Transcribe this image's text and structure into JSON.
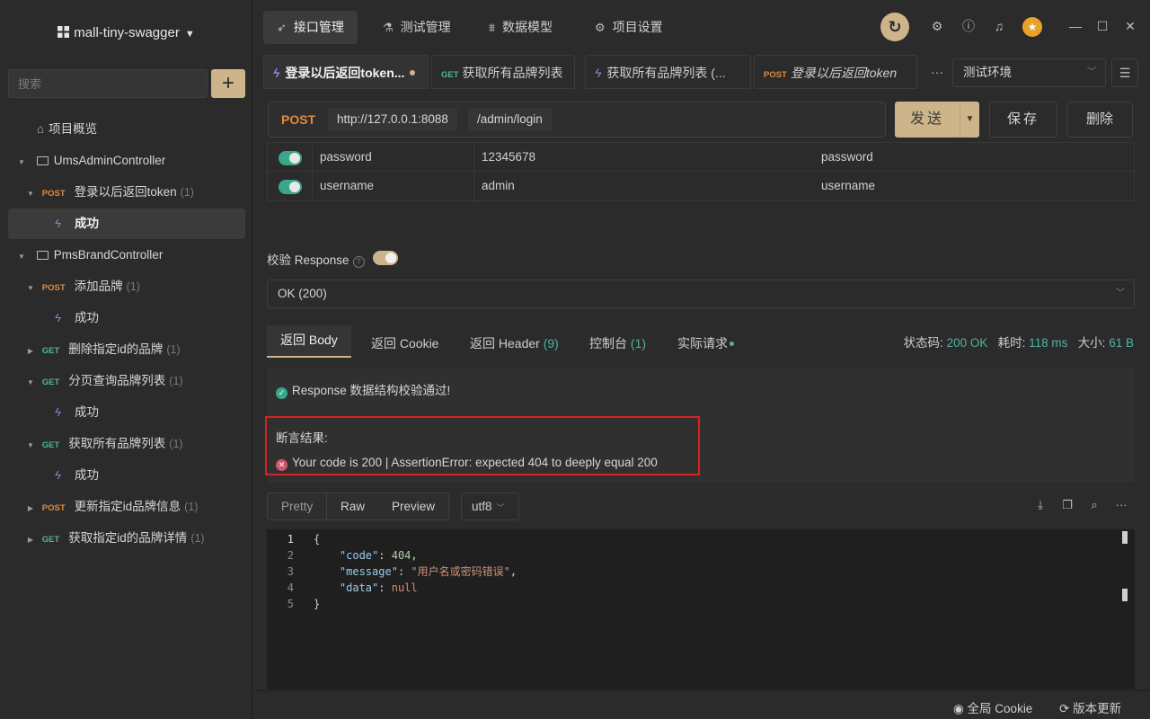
{
  "project": {
    "name": "mall-tiny-swagger"
  },
  "search": {
    "placeholder": "搜索"
  },
  "sidebar": {
    "overview": "项目概览",
    "items": [
      {
        "type": "folder",
        "label": "UmsAdminController"
      },
      {
        "type": "api",
        "method": "POST",
        "label": "登录以后返回token",
        "count": "(1)"
      },
      {
        "type": "case",
        "label": "成功"
      },
      {
        "type": "folder",
        "label": "PmsBrandController"
      },
      {
        "type": "api",
        "method": "POST",
        "label": "添加品牌",
        "count": "(1)"
      },
      {
        "type": "case",
        "label": "成功"
      },
      {
        "type": "api",
        "method": "GET",
        "label": "删除指定id的品牌",
        "count": "(1)"
      },
      {
        "type": "api",
        "method": "GET",
        "label": "分页查询品牌列表",
        "count": "(1)"
      },
      {
        "type": "case",
        "label": "成功"
      },
      {
        "type": "api",
        "method": "GET",
        "label": "获取所有品牌列表",
        "count": "(1)"
      },
      {
        "type": "case",
        "label": "成功"
      },
      {
        "type": "api",
        "method": "POST",
        "label": "更新指定id品牌信息",
        "count": "(1)"
      },
      {
        "type": "api",
        "method": "GET",
        "label": "获取指定id的品牌详情",
        "count": "(1)"
      }
    ]
  },
  "topnav": {
    "tabs": [
      "接口管理",
      "测试管理",
      "数据模型",
      "项目设置"
    ]
  },
  "request_tabs": [
    {
      "kind": "case",
      "label": "登录以后返回token..."
    },
    {
      "kind": "GET",
      "label": "获取所有品牌列表"
    },
    {
      "kind": "case",
      "label": "获取所有品牌列表 (..."
    },
    {
      "kind": "POST",
      "label": "登录以后返回token"
    }
  ],
  "environment": "测试环境",
  "url": {
    "method": "POST",
    "host": "http://127.0.0.1:8088",
    "path": "/admin/login"
  },
  "actions": {
    "send": "发送",
    "save": "保存",
    "delete": "删除"
  },
  "params": [
    {
      "name": "password",
      "value": "12345678",
      "description": "password"
    },
    {
      "name": "username",
      "value": "admin",
      "description": "username"
    }
  ],
  "validation": {
    "label": "校验 Response",
    "status": "OK (200)"
  },
  "response_tabs": {
    "body": "返回 Body",
    "cookie": "返回 Cookie",
    "header": "返回 Header",
    "header_count": "(9)",
    "console": "控制台",
    "console_count": "(1)",
    "actual": "实际请求"
  },
  "response_meta": {
    "status_label": "状态码:",
    "status_value": "200 OK",
    "time_label": "耗时:",
    "time_value": "118 ms",
    "size_label": "大小:",
    "size_value": "61 B"
  },
  "results": {
    "schema_ok": "Response 数据结构校验通过!",
    "assert_title": "断言结果:",
    "assert_error": "Your code is 200 | AssertionError: expected 404 to deeply equal 200"
  },
  "view": {
    "pretty": "Pretty",
    "raw": "Raw",
    "preview": "Preview",
    "encoding": "utf8"
  },
  "code": {
    "key_code": "\"code\"",
    "val_code": "404",
    "key_message": "\"message\"",
    "val_message": "\"用户名或密码错误\"",
    "key_data": "\"data\"",
    "val_data": "null"
  },
  "statusbar": {
    "cookie": "全局 Cookie",
    "update": "版本更新"
  },
  "colors": {
    "accent": "#cdb48a",
    "post": "#e08a3c",
    "get": "#4fb3a0",
    "error_border": "#d62424"
  }
}
